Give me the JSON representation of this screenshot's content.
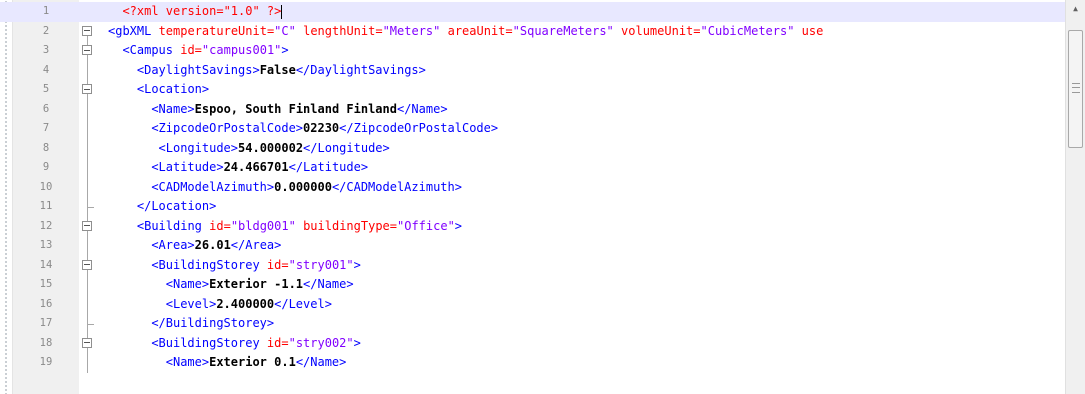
{
  "editor": {
    "lines": [
      {
        "num": "1",
        "indent": 2,
        "fold": "none",
        "html": [
          [
            "pi",
            "<?xml version=\"1.0\" ?>"
          ]
        ],
        "current": true
      },
      {
        "num": "2",
        "indent": 0,
        "fold": "open",
        "html": [
          [
            "tag",
            "<gbXML "
          ],
          [
            "attr",
            "temperatureUnit="
          ],
          [
            "val",
            "\"C\""
          ],
          [
            "tag",
            " "
          ],
          [
            "attr",
            "lengthUnit="
          ],
          [
            "val",
            "\"Meters\""
          ],
          [
            "tag",
            " "
          ],
          [
            "attr",
            "areaUnit="
          ],
          [
            "val",
            "\"SquareMeters\""
          ],
          [
            "tag",
            " "
          ],
          [
            "attr",
            "volumeUnit="
          ],
          [
            "val",
            "\"CubicMeters\""
          ],
          [
            "tag",
            " "
          ],
          [
            "attr",
            "use"
          ]
        ]
      },
      {
        "num": "3",
        "indent": 2,
        "fold": "open",
        "html": [
          [
            "tag",
            "<Campus "
          ],
          [
            "attr",
            "id="
          ],
          [
            "val",
            "\"campus001\""
          ],
          [
            "tag",
            ">"
          ]
        ]
      },
      {
        "num": "4",
        "indent": 4,
        "fold": "line",
        "html": [
          [
            "tag",
            "<DaylightSavings>"
          ],
          [
            "txt",
            "False"
          ],
          [
            "tag",
            "</DaylightSavings>"
          ]
        ]
      },
      {
        "num": "5",
        "indent": 4,
        "fold": "open",
        "html": [
          [
            "tag",
            "<Location>"
          ]
        ]
      },
      {
        "num": "6",
        "indent": 6,
        "fold": "line",
        "html": [
          [
            "tag",
            "<Name>"
          ],
          [
            "txt",
            "Espoo, South Finland Finland"
          ],
          [
            "tag",
            "</Name>"
          ]
        ]
      },
      {
        "num": "7",
        "indent": 6,
        "fold": "line",
        "html": [
          [
            "tag",
            "<ZipcodeOrPostalCode>"
          ],
          [
            "txt",
            "02230"
          ],
          [
            "tag",
            "</ZipcodeOrPostalCode>"
          ]
        ]
      },
      {
        "num": "8",
        "indent": 7,
        "fold": "line",
        "html": [
          [
            "tag",
            "<Longitude>"
          ],
          [
            "txt",
            "54.000002"
          ],
          [
            "tag",
            "</Longitude>"
          ]
        ]
      },
      {
        "num": "9",
        "indent": 6,
        "fold": "line",
        "html": [
          [
            "tag",
            "<Latitude>"
          ],
          [
            "txt",
            "24.466701"
          ],
          [
            "tag",
            "</Latitude>"
          ]
        ]
      },
      {
        "num": "10",
        "indent": 6,
        "fold": "line",
        "html": [
          [
            "tag",
            "<CADModelAzimuth>"
          ],
          [
            "txt",
            "0.000000"
          ],
          [
            "tag",
            "</CADModelAzimuth>"
          ]
        ]
      },
      {
        "num": "11",
        "indent": 4,
        "fold": "end",
        "html": [
          [
            "tag",
            "</Location>"
          ]
        ]
      },
      {
        "num": "12",
        "indent": 4,
        "fold": "open",
        "html": [
          [
            "tag",
            "<Building "
          ],
          [
            "attr",
            "id="
          ],
          [
            "val",
            "\"bldg001\""
          ],
          [
            "tag",
            " "
          ],
          [
            "attr",
            "buildingType="
          ],
          [
            "val",
            "\"Office\""
          ],
          [
            "tag",
            ">"
          ]
        ]
      },
      {
        "num": "13",
        "indent": 6,
        "fold": "line",
        "html": [
          [
            "tag",
            "<Area>"
          ],
          [
            "txt",
            "26.01"
          ],
          [
            "tag",
            "</Area>"
          ]
        ]
      },
      {
        "num": "14",
        "indent": 6,
        "fold": "open",
        "html": [
          [
            "tag",
            "<BuildingStorey "
          ],
          [
            "attr",
            "id="
          ],
          [
            "val",
            "\"stry001\""
          ],
          [
            "tag",
            ">"
          ]
        ]
      },
      {
        "num": "15",
        "indent": 8,
        "fold": "line",
        "html": [
          [
            "tag",
            "<Name>"
          ],
          [
            "txt",
            "Exterior -1.1"
          ],
          [
            "tag",
            "</Name>"
          ]
        ]
      },
      {
        "num": "16",
        "indent": 8,
        "fold": "line",
        "html": [
          [
            "tag",
            "<Level>"
          ],
          [
            "txt",
            "2.400000"
          ],
          [
            "tag",
            "</Level>"
          ]
        ]
      },
      {
        "num": "17",
        "indent": 6,
        "fold": "end",
        "html": [
          [
            "tag",
            "</BuildingStorey>"
          ]
        ]
      },
      {
        "num": "18",
        "indent": 6,
        "fold": "open",
        "html": [
          [
            "tag",
            "<BuildingStorey "
          ],
          [
            "attr",
            "id="
          ],
          [
            "val",
            "\"stry002\""
          ],
          [
            "tag",
            ">"
          ]
        ]
      },
      {
        "num": "19",
        "indent": 8,
        "fold": "line",
        "html": [
          [
            "tag",
            "<Name>"
          ],
          [
            "txt",
            "Exterior 0.1"
          ],
          [
            "tag",
            "</Name>"
          ]
        ]
      }
    ]
  },
  "scrollbar": {
    "up_icon": "triangle-up",
    "grip_icon": "grip-lines"
  }
}
